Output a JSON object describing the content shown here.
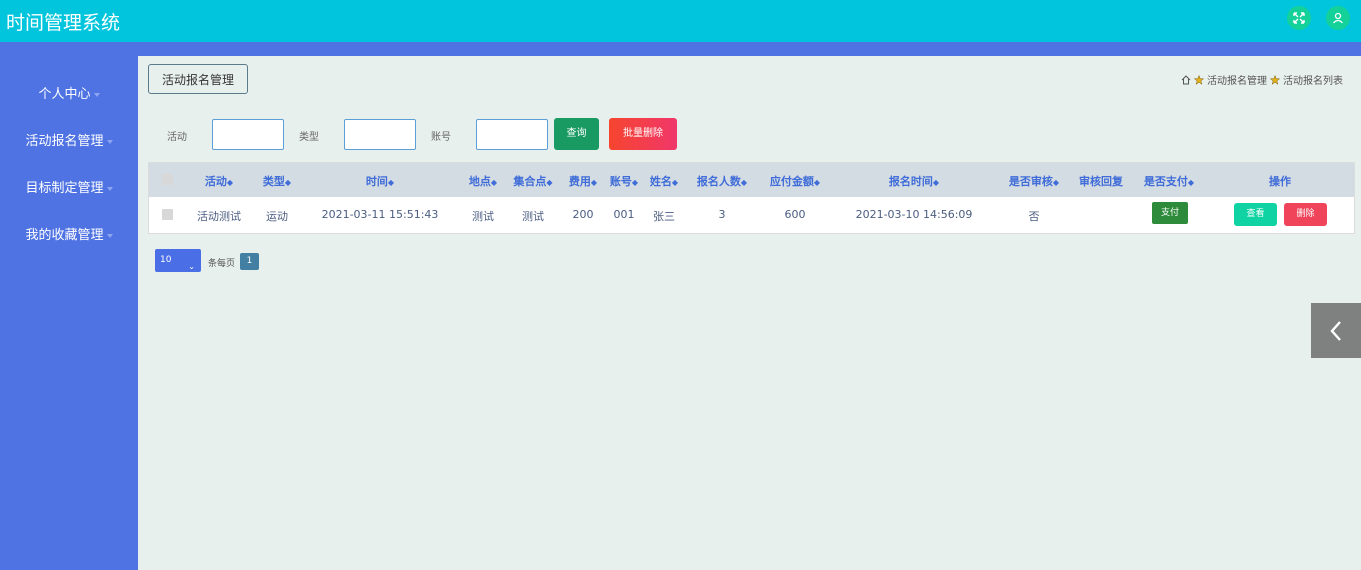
{
  "app": {
    "title": "时间管理系统"
  },
  "header": {
    "fullscreen_icon": "expand-icon",
    "user_icon": "user-icon"
  },
  "sidebar": {
    "items": [
      {
        "label": "个人中心"
      },
      {
        "label": "活动报名管理"
      },
      {
        "label": "目标制定管理"
      },
      {
        "label": "我的收藏管理"
      }
    ]
  },
  "page": {
    "title_button": "活动报名管理",
    "breadcrumb": [
      "活动报名管理",
      "活动报名列表"
    ]
  },
  "search": {
    "activity_label": "活动",
    "type_label": "类型",
    "account_label": "账号",
    "activity_value": "",
    "type_value": "",
    "account_value": "",
    "query_button": "查询",
    "batch_delete_button": "批量删除"
  },
  "table": {
    "headers": [
      "活动",
      "类型",
      "时间",
      "地点",
      "集合点",
      "费用",
      "账号",
      "姓名",
      "报名人数",
      "应付金额",
      "报名时间",
      "是否审核",
      "审核回复",
      "是否支付",
      "操作"
    ],
    "rows": [
      {
        "activity": "活动测试",
        "type": "运动",
        "time": "2021-03-11 15:51:43",
        "location": "测试",
        "meeting_point": "测试",
        "fee": "200",
        "account": "001",
        "name": "张三",
        "count": "3",
        "amount": "600",
        "signup_time": "2021-03-10 14:56:09",
        "reviewed": "否",
        "review_reply": "",
        "pay_button": "支付",
        "view_button": "查看",
        "delete_button": "删除"
      }
    ]
  },
  "pagination": {
    "page_size": "10",
    "per_page_label": "条每页",
    "current_page": "1"
  },
  "colors": {
    "header": "#00c5dd",
    "sidebar": "#4f73e3",
    "accent_green": "#1a9a63",
    "danger": "#f0445a"
  }
}
